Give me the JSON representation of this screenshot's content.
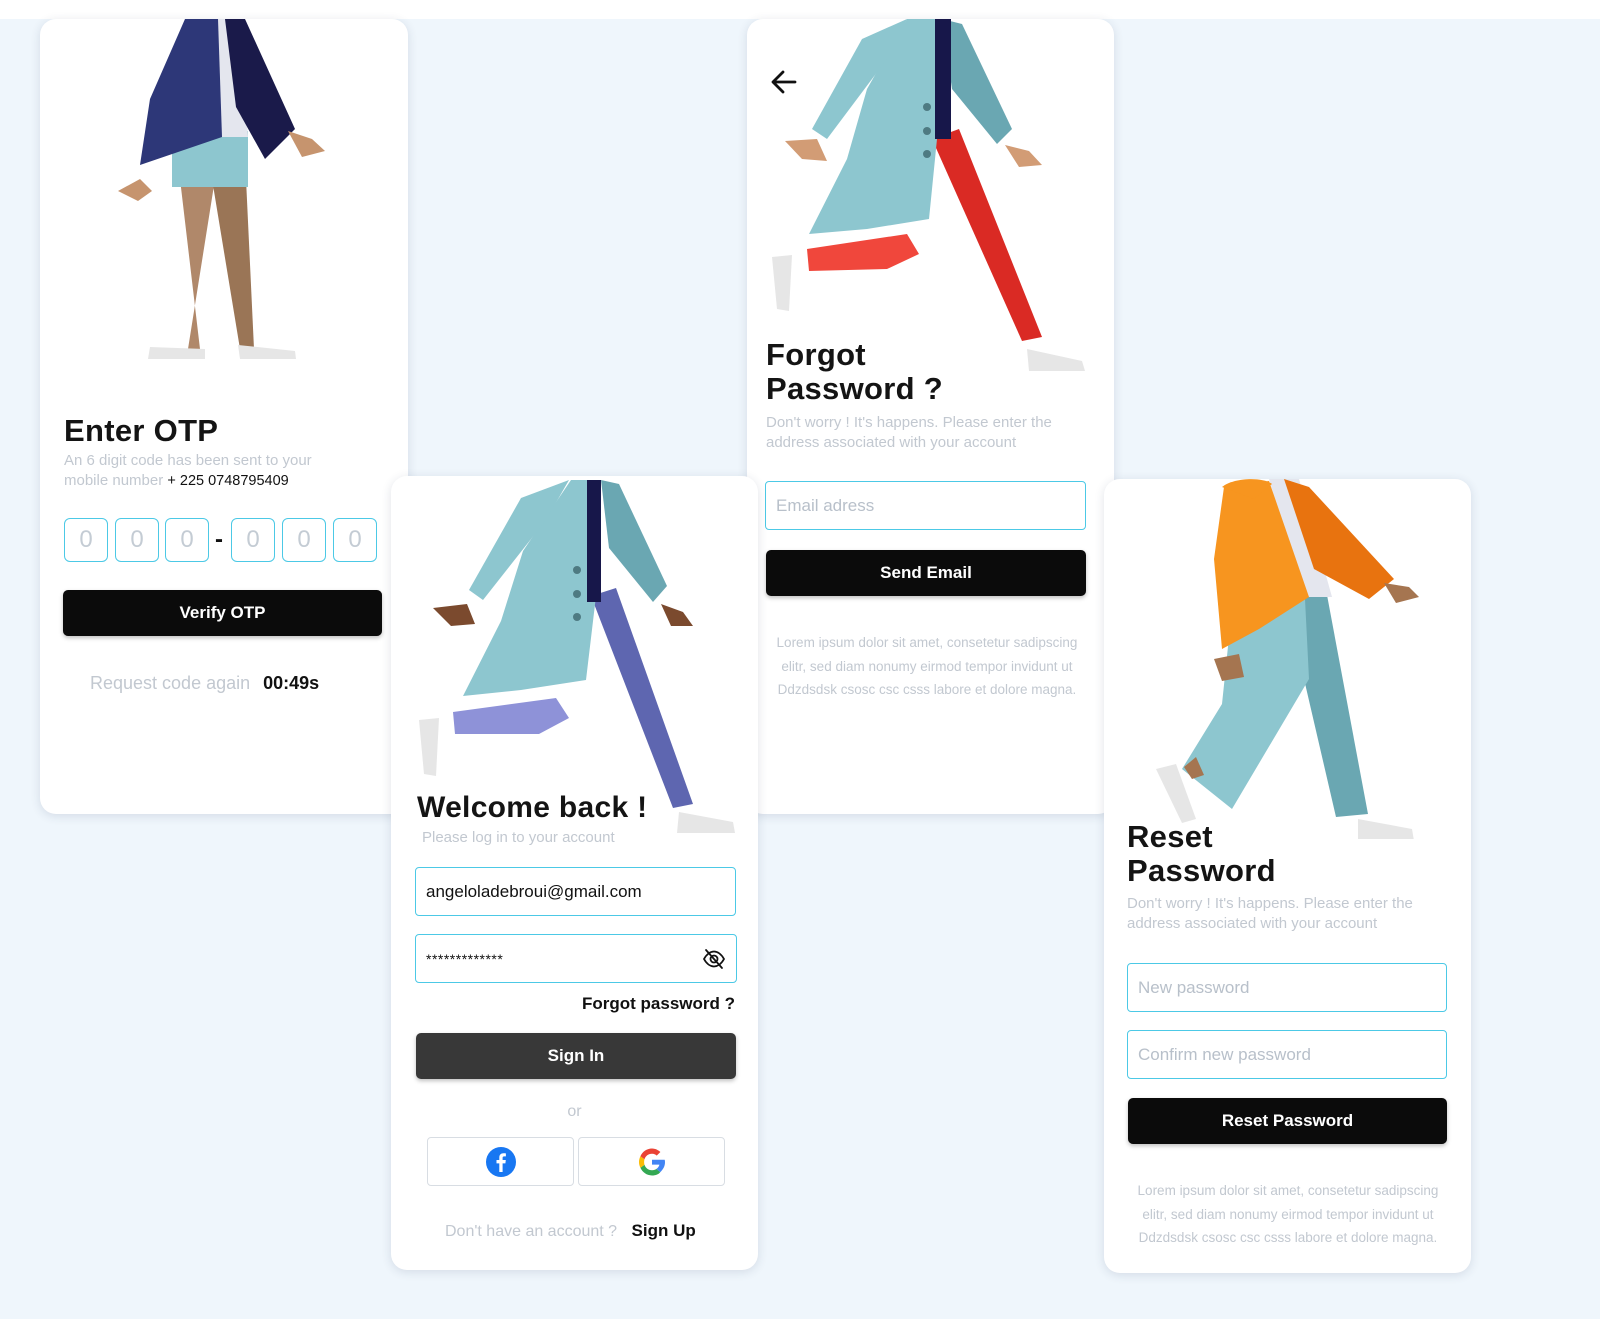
{
  "otp": {
    "title": "Enter OTP",
    "subtitle_line1": "An 6 digit code has been sent to your",
    "subtitle_line2_prefix": "mobile number",
    "phone": "+ 225 0748795409",
    "digits": [
      "0",
      "0",
      "0",
      "0",
      "0",
      "0"
    ],
    "separator": "-",
    "verify_label": "Verify OTP",
    "request_label": "Request code again",
    "timer": "00:49s"
  },
  "login": {
    "title": "Welcome back !",
    "subtitle": "Please log in to your account",
    "email_value": "angeloladebroui@gmail.com",
    "password_value": "*************",
    "forgot_label": "Forgot password ?",
    "signin_label": "Sign In",
    "or_label": "or",
    "no_account_label": "Don't have an account ?",
    "signup_label": "Sign Up"
  },
  "forgot": {
    "title_line1": "Forgot",
    "title_line2": "Password ?",
    "subtitle_line1": "Don't worry ! It's happens. Please enter the",
    "subtitle_line2": "address associated with your account",
    "email_placeholder": "Email adress",
    "send_label": "Send Email",
    "lorem_line1": "Lorem ipsum dolor sit amet, consetetur sadipscing",
    "lorem_line2": "elitr, sed diam nonumy eirmod tempor invidunt ut",
    "lorem_line3": "Ddzdsdsk csosc csc csss   labore et dolore magna."
  },
  "reset": {
    "title_line1": "Reset",
    "title_line2": "Password",
    "subtitle_line1": "Don't worry ! It's happens. Please enter the",
    "subtitle_line2": "address associated with your account",
    "new_placeholder": "New password",
    "confirm_placeholder": "Confirm new password",
    "reset_label": "Reset Password",
    "lorem_line1": "Lorem ipsum dolor sit amet, consetetur sadipscing",
    "lorem_line2": "elitr, sed diam nonumy eirmod tempor invidunt ut",
    "lorem_line3": "Ddzdsdsk csosc csc csss   labore et dolore magna."
  },
  "colors": {
    "accent": "#4cc9e6",
    "button": "#0b0b0b",
    "muted_text": "#c2c8d0",
    "background": "#eff6fc"
  },
  "icons": {
    "back": "arrow-left-icon",
    "eye": "eye-off-icon",
    "facebook": "facebook-icon",
    "google": "google-icon"
  }
}
